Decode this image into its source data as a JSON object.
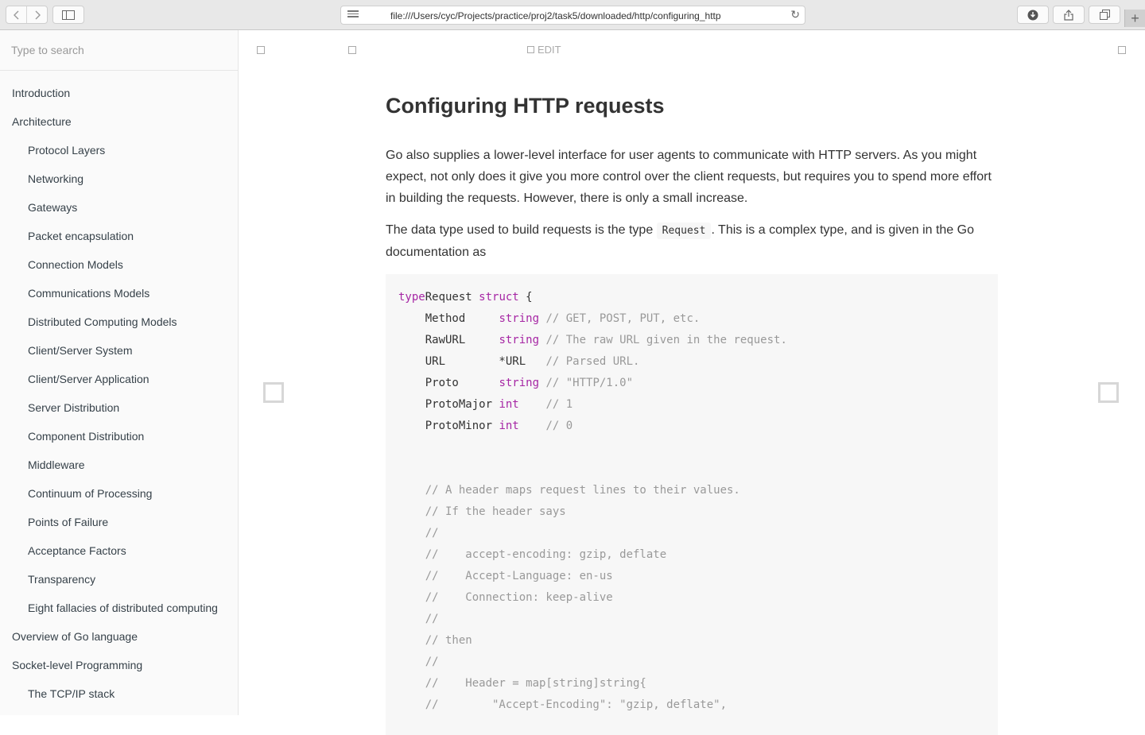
{
  "browser": {
    "url": "file:///Users/cyc/Projects/practice/proj2/task5/downloaded/http/configuring_http"
  },
  "sidebar": {
    "search_placeholder": "Type to search",
    "items": [
      {
        "label": "Introduction",
        "level": 1
      },
      {
        "label": "Architecture",
        "level": 1
      },
      {
        "label": "Protocol Layers",
        "level": 2
      },
      {
        "label": "Networking",
        "level": 2
      },
      {
        "label": "Gateways",
        "level": 2
      },
      {
        "label": "Packet encapsulation",
        "level": 2
      },
      {
        "label": "Connection Models",
        "level": 2
      },
      {
        "label": "Communications Models",
        "level": 2
      },
      {
        "label": "Distributed Computing Models",
        "level": 2
      },
      {
        "label": "Client/Server System",
        "level": 2
      },
      {
        "label": "Client/Server Application",
        "level": 2
      },
      {
        "label": "Server Distribution",
        "level": 2
      },
      {
        "label": "Component Distribution",
        "level": 2
      },
      {
        "label": "Middleware",
        "level": 2
      },
      {
        "label": "Continuum of Processing",
        "level": 2
      },
      {
        "label": "Points of Failure",
        "level": 2
      },
      {
        "label": "Acceptance Factors",
        "level": 2
      },
      {
        "label": "Transparency",
        "level": 2
      },
      {
        "label": "Eight fallacies of distributed computing",
        "level": 2
      },
      {
        "label": "Overview of Go language",
        "level": 1
      },
      {
        "label": "Socket-level Programming",
        "level": 1
      },
      {
        "label": "The TCP/IP stack",
        "level": 2
      }
    ]
  },
  "header": {
    "edit_label": "EDIT"
  },
  "page": {
    "title": "Configuring HTTP requests",
    "para1": "Go also supplies a lower-level interface for user agents to communicate with HTTP servers. As you might expect, not only does it give you more control over the client requests, but requires you to spend more effort in building the requests. However, there is only a small increase.",
    "para2_before": "The data type used to build requests is the type ",
    "para2_code": "Request",
    "para2_after": ". This is a complex type, and is given in the Go documentation as"
  },
  "code_lines": [
    [
      [
        "kw",
        "type"
      ],
      [
        "",
        "Request "
      ],
      [
        "kw",
        "struct"
      ],
      [
        "",
        " {"
      ]
    ],
    [
      [
        "",
        "    Method     "
      ],
      [
        "kw",
        "string"
      ],
      [
        "cm",
        " // GET, POST, PUT, etc."
      ]
    ],
    [
      [
        "",
        "    RawURL     "
      ],
      [
        "kw",
        "string"
      ],
      [
        "cm",
        " // The raw URL given in the request."
      ]
    ],
    [
      [
        "",
        "    URL        *URL   "
      ],
      [
        "cm",
        "// Parsed URL."
      ]
    ],
    [
      [
        "",
        "    Proto      "
      ],
      [
        "kw",
        "string"
      ],
      [
        "cm",
        " // \"HTTP/1.0\""
      ]
    ],
    [
      [
        "",
        "    ProtoMajor "
      ],
      [
        "kw",
        "int"
      ],
      [
        "cm",
        "    // 1"
      ]
    ],
    [
      [
        "",
        "    ProtoMinor "
      ],
      [
        "kw",
        "int"
      ],
      [
        "cm",
        "    // 0"
      ]
    ],
    [
      [
        "",
        ""
      ]
    ],
    [
      [
        "",
        ""
      ]
    ],
    [
      [
        "cm",
        "    // A header maps request lines to their values."
      ]
    ],
    [
      [
        "cm",
        "    // If the header says"
      ]
    ],
    [
      [
        "cm",
        "    //"
      ]
    ],
    [
      [
        "cm",
        "    //    accept-encoding: gzip, deflate"
      ]
    ],
    [
      [
        "cm",
        "    //    Accept-Language: en-us"
      ]
    ],
    [
      [
        "cm",
        "    //    Connection: keep-alive"
      ]
    ],
    [
      [
        "cm",
        "    //"
      ]
    ],
    [
      [
        "cm",
        "    // then"
      ]
    ],
    [
      [
        "cm",
        "    //"
      ]
    ],
    [
      [
        "cm",
        "    //    Header = map[string]string{"
      ]
    ],
    [
      [
        "cm",
        "    //        \"Accept-Encoding\": \"gzip, deflate\","
      ]
    ]
  ]
}
